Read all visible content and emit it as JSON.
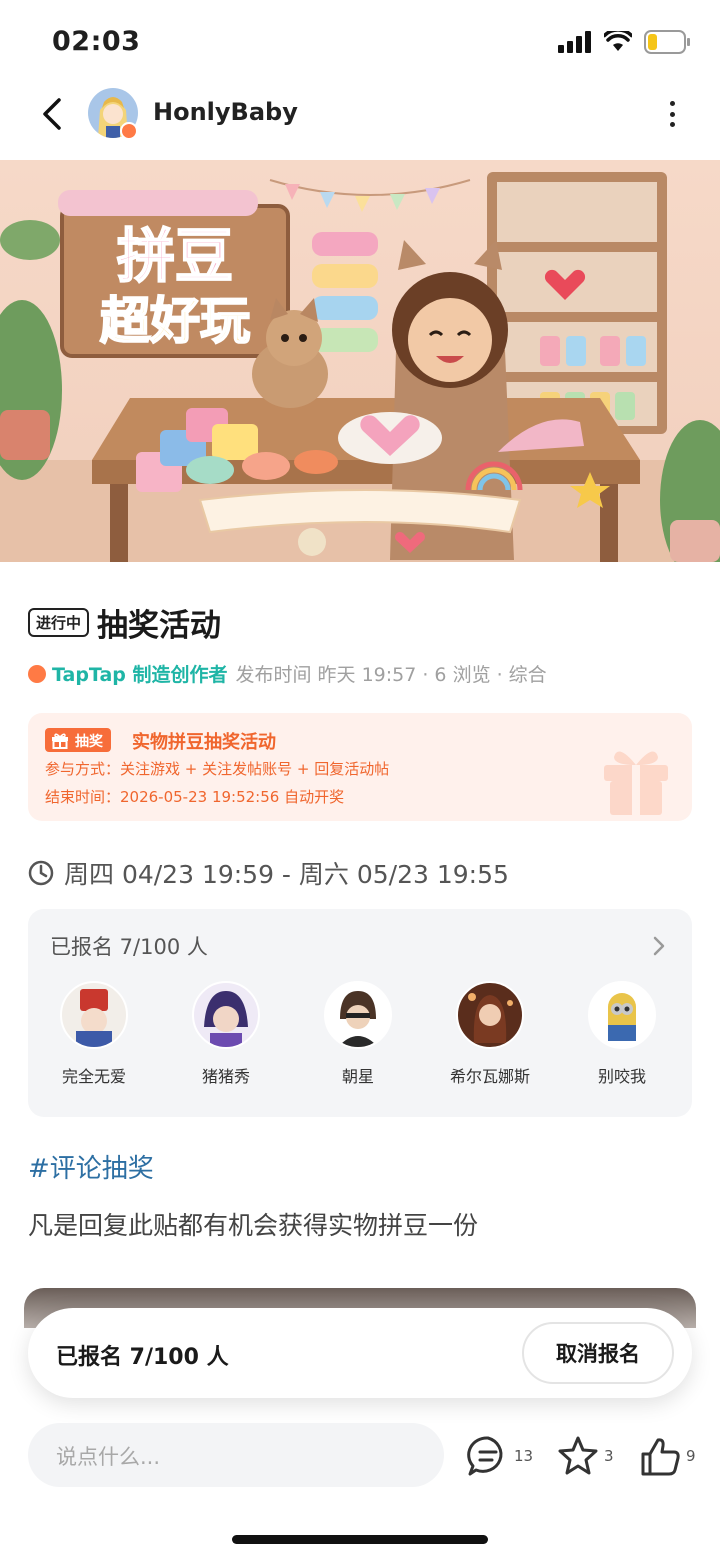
{
  "status_bar": {
    "time": "02:03"
  },
  "nav": {
    "username": "HonlyBaby"
  },
  "banner": {
    "line1": "拼豆",
    "line2": "超好玩"
  },
  "post": {
    "status_tag": "进行中",
    "title": "抽奖活动",
    "author_label": "TapTap 制造创作者",
    "meta": "发布时间 昨天 19:57 · 6 浏览 · 综合"
  },
  "lottery": {
    "badge": "抽奖",
    "title": "实物拼豆抽奖活动",
    "participation": "参与方式：关注游戏 + 关注发帖账号 + 回复活动帖",
    "end_time": "结束时间：2026-05-23 19:52:56 自动开奖"
  },
  "event_time": "周四 04/23 19:59 - 周六 05/23 19:55",
  "signup": {
    "header": "已报名 7/100 人",
    "participants": [
      {
        "name": "完全无爱",
        "color": "#c9382e"
      },
      {
        "name": "猪猪秀",
        "color": "#5b3c8f"
      },
      {
        "name": "朝星",
        "color": "#4a3326"
      },
      {
        "name": "希尔瓦娜斯",
        "color": "#7a3a22"
      },
      {
        "name": "别咬我",
        "color": "#d8b23a"
      }
    ]
  },
  "hashtag": "#评论抽奖",
  "body_text": "凡是回复此贴都有机会获得实物拼豆一份",
  "bottom_bar": {
    "signup_text": "已报名 7/100 人",
    "cancel_label": "取消报名",
    "comment_placeholder": "说点什么...",
    "comments": "13",
    "favorites": "3",
    "likes": "9"
  },
  "colors": {
    "accent_orange": "#f0662e",
    "taptap_teal": "#1fb5a6",
    "hashtag_blue": "#2d6fa3"
  }
}
